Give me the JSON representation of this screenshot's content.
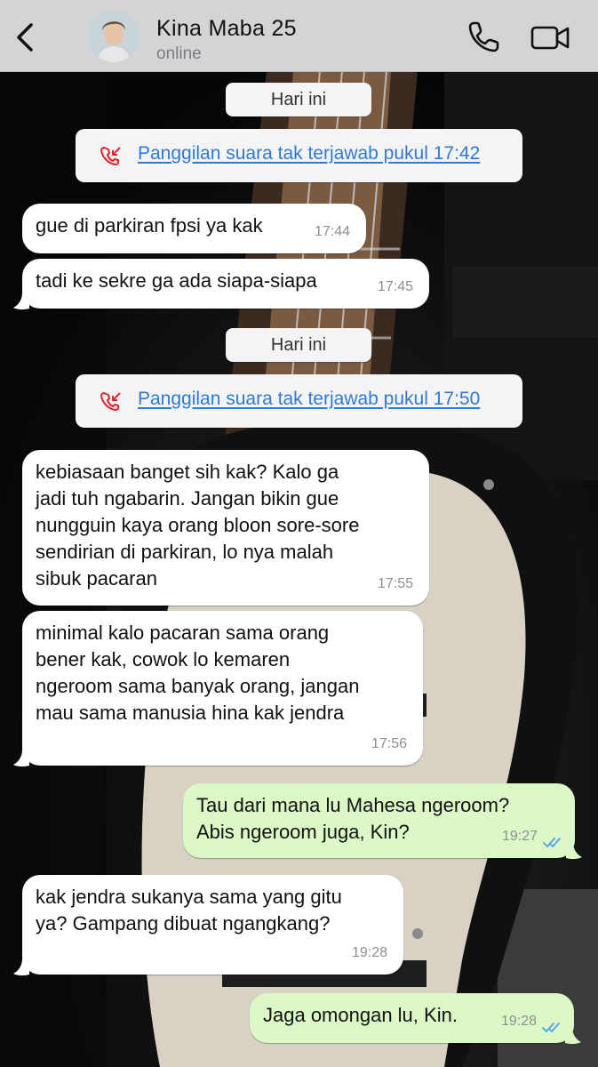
{
  "header": {
    "contact_name": "Kina Maba 25",
    "status": "online"
  },
  "dates": {
    "first": "Hari ini",
    "second": "Hari ini"
  },
  "calls": {
    "first": "Panggilan suara tak terjawab pukul 17:42",
    "second": "Panggilan suara tak terjawab pukul 17:50"
  },
  "messages": [
    {
      "text": "gue di parkiran fpsi ya kak",
      "time": "17:44"
    },
    {
      "text": "tadi ke sekre ga ada siapa-siapa",
      "time": "17:45"
    },
    {
      "text": "kebiasaan banget sih kak? Kalo ga\njadi tuh ngabarin. Jangan bikin gue\nnungguin kaya orang bloon sore-sore\nsendirian di parkiran, lo nya malah\nsibuk pacaran",
      "time": "17:55"
    },
    {
      "text": "minimal kalo pacaran sama orang\nbener kak, cowok lo kemaren\nngeroom sama banyak orang, jangan\nmau sama manusia hina kak jendra",
      "time": "17:56"
    },
    {
      "text": "Tau dari mana lu Mahesa ngeroom?\nAbis ngeroom juga, Kin?",
      "time": "19:27"
    },
    {
      "text": "kak jendra sukanya sama yang gitu\nya? Gampang dibuat ngangkang?",
      "time": "19:28"
    },
    {
      "text": "Jaga omongan lu, Kin.",
      "time": "19:28"
    }
  ],
  "colors": {
    "header_bg": "#d4d4d6",
    "incoming_bubble": "#ffffff",
    "outgoing_bubble": "#dcf8c6",
    "link_blue": "#2f7ad6",
    "missed_red": "#e0222b",
    "read_ticks": "#4fa3e8"
  },
  "icons": {
    "back": "chevron-left-icon",
    "call": "phone-icon",
    "video": "video-camera-icon",
    "missed_call": "missed-call-icon",
    "read": "double-check-icon"
  }
}
